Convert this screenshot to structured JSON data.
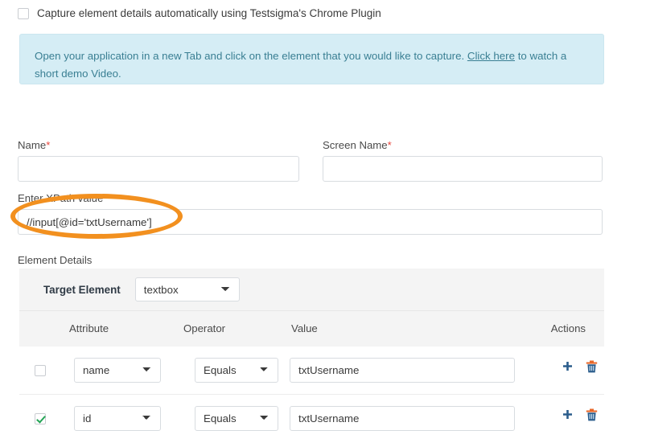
{
  "plugin_option": {
    "label": "Capture element details automatically using Testsigma's Chrome Plugin",
    "checked": false
  },
  "info_banner": {
    "text_before_link": "Open your application in a new Tab and click on the element that you would like to capture. ",
    "link_text": "Click here",
    "text_after_link": " to watch a short demo Video.",
    "background_color": "#d5edf5",
    "text_color": "#3a7f93"
  },
  "form": {
    "name": {
      "label": "Name",
      "required_marker": "*",
      "value": "",
      "placeholder": ""
    },
    "screen_name": {
      "label": "Screen Name",
      "required_marker": "*",
      "value": "",
      "placeholder": ""
    },
    "xpath": {
      "label": "Enter XPath value",
      "value": "//input[@id='txtUsername']",
      "placeholder": ""
    }
  },
  "annotation": {
    "shape": "ellipse",
    "color": "#f2901f",
    "target": "xpath-input"
  },
  "element_details": {
    "section_label": "Element Details",
    "target_element": {
      "label": "Target Element",
      "selected": "textbox",
      "options": [
        "textbox"
      ]
    },
    "columns": {
      "attribute": "Attribute",
      "operator": "Operator",
      "value": "Value",
      "actions": "Actions"
    },
    "rows": [
      {
        "checked": false,
        "attribute": "name",
        "attribute_options": [
          "name"
        ],
        "operator": "Equals",
        "operator_options": [
          "Equals"
        ],
        "value": "txtUsername",
        "add_icon": "plus-icon",
        "delete_icon": "trash-icon"
      },
      {
        "checked": true,
        "attribute": "id",
        "attribute_options": [
          "id"
        ],
        "operator": "Equals",
        "operator_options": [
          "Equals"
        ],
        "value": "txtUsername",
        "add_icon": "plus-icon",
        "delete_icon": "trash-icon"
      }
    ]
  }
}
